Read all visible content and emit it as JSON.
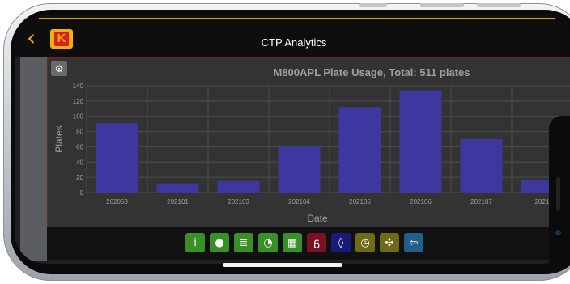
{
  "app": {
    "title": "CTP Analytics",
    "logo_letter": "K",
    "back_glyph": "‹"
  },
  "colors": {
    "accent": "#e9b320",
    "bar": "#3f37a0",
    "panel_bg": "#333333",
    "panel_border": "#7a1f22"
  },
  "chart": {
    "settings_icon": "gear-icon"
  },
  "chart_data": {
    "type": "bar",
    "title": "M800APL Plate Usage, Total: 511 plates",
    "xlabel": "Date",
    "ylabel": "Plates",
    "categories": [
      "202053",
      "202101",
      "202103",
      "202104",
      "202105",
      "202106",
      "202107",
      "2021"
    ],
    "values": [
      91,
      12,
      15,
      60,
      112,
      134,
      70,
      17
    ],
    "ylim": [
      0,
      140
    ],
    "yticks": [
      0,
      20,
      40,
      60,
      80,
      100,
      120,
      140
    ],
    "grid": true
  },
  "toolbar": {
    "items": [
      {
        "name": "info-icon",
        "bg": "#3a8f26",
        "glyph": "i"
      },
      {
        "name": "green-circle-icon",
        "bg": "#3a8f26",
        "glyph": "●"
      },
      {
        "name": "list-icon",
        "bg": "#3a8f26",
        "glyph": "≣"
      },
      {
        "name": "pie-chart-icon",
        "bg": "#3a8f26",
        "glyph": "◔"
      },
      {
        "name": "calculator-icon",
        "bg": "#3a8f26",
        "glyph": "▦"
      },
      {
        "name": "thermometer-icon",
        "bg": "#7a1020",
        "glyph": "ᵷ"
      },
      {
        "name": "water-drop-icon",
        "bg": "#1a1a7a",
        "glyph": "◊"
      },
      {
        "name": "gauge-icon",
        "bg": "#6f6a18",
        "glyph": "◷"
      },
      {
        "name": "puzzle-icon",
        "bg": "#6f6a18",
        "glyph": "✣"
      },
      {
        "name": "back-arrow-icon",
        "bg": "#225e8a",
        "glyph": "⇦"
      }
    ]
  }
}
